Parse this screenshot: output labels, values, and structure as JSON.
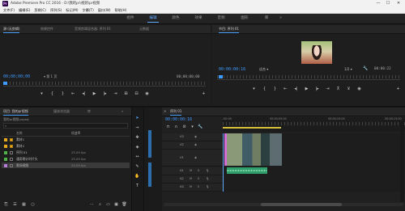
{
  "titlebar": {
    "app_icon_letters": "Pr",
    "title": "Adobe Premiere Pro CC 2016 - D:\\我的pr\\视频\\pr视频",
    "minimize": "—",
    "maximize": "☐",
    "close": "✕"
  },
  "menubar": {
    "items": [
      "文件(F)",
      "编辑(E)",
      "剪辑(C)",
      "序列(S)",
      "标记(M)",
      "字幕(T)",
      "窗口(W)",
      "帮助(H)"
    ]
  },
  "workspace": {
    "tabs": [
      "组件",
      "编辑",
      "颜色",
      "效果",
      "音频",
      "图形",
      "库"
    ],
    "active": "编辑"
  },
  "source_panel": {
    "tabs": [
      "源:(无剪辑)",
      "效果控件",
      "音频剪辑混合器: 序列 01",
      "元数据"
    ],
    "timecode_left": "00;00;00;00",
    "page_label": "第 1 页",
    "timecode_right": "00;00;00;00"
  },
  "program_panel": {
    "tab": "节目: 序列 01",
    "timecode_left": "00:00:00:16",
    "fit_label": "适合",
    "scale_label": "1/2",
    "timecode_right": "00:00:22"
  },
  "project_panel": {
    "tabs": [
      "项目: 我的pr视频",
      "媒体浏览器",
      "库"
    ],
    "project_file": "我的pr视频.prproj",
    "search_icon": "search-icon",
    "col_name": "名称",
    "col_framerate": "帧速率",
    "items": [
      {
        "name": "素材1",
        "framerate": "",
        "color": "#e6a821",
        "kind": "bin"
      },
      {
        "name": "素材2",
        "framerate": "",
        "color": "#e6a821",
        "kind": "bin"
      },
      {
        "name": "序列 01",
        "framerate": "25.00 fps",
        "color": "#4fb34a",
        "kind": "sequence"
      },
      {
        "name": "通用倒计时片头",
        "framerate": "25.00 fps",
        "color": "#4fb34a",
        "kind": "sequence"
      },
      {
        "name": "黑场视频",
        "framerate": "25.00 fps",
        "color": "#b67ad9",
        "kind": "clip"
      }
    ]
  },
  "timeline": {
    "tab": "序列 01",
    "timecode": "00:00:00:16",
    "ruler_labels": [
      ":00:00",
      "00:00:05:00",
      "00:00:10:00",
      "00:00:15:00"
    ],
    "video_tracks": [
      "V3",
      "V2",
      "V1"
    ],
    "audio_tracks": [
      "A1",
      "A2",
      "A3"
    ],
    "track_buttons": [
      "M",
      "S"
    ]
  },
  "colors": {
    "accent_blue": "#3e9bff",
    "playhead": "#5ea8ff",
    "audio_clip": "#2f9e6b",
    "video_clip_marker": "#d26ed5",
    "source_track_blue": "#2d6fae"
  }
}
